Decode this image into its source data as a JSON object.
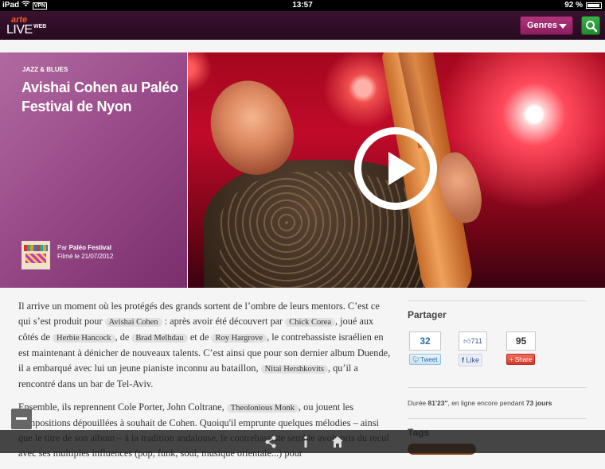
{
  "status_bar": {
    "device": "iPad",
    "vpn": "VPN",
    "time": "13:57",
    "battery": "92 %"
  },
  "header": {
    "logo_arte": "arte",
    "logo_live": "LIVE",
    "logo_web": "WEB",
    "genres_label": "Genres"
  },
  "hero": {
    "category": "JAZZ & BLUES",
    "title": "Avishai Cohen au Paléo Festival de Nyon",
    "by_prefix": "Par ",
    "by_name": "Paléo Festival",
    "filmed": "Filmé le 21/07/2012"
  },
  "article": {
    "p1": {
      "t1": "Il arrive un moment où les protégés des grands sortent de l’ombre de leurs mentors. C’est ce qui s’est produit pour",
      "l1": "Avishai Cohen",
      "t2": ": après avoir été découvert par",
      "l2": "Chick Corea",
      "t3": ", joué aux côtés de",
      "l3": "Herbie Hancock",
      "t4": ", de",
      "l4": "Brad Melhdau",
      "t5": "et de",
      "l5": "Roy Hargrove",
      "t6": ", le contrebassiste israélien en est maintenant à dénicher de nouveaux talents. C’est ainsi que pour son dernier album Duende, il a embarqué avec lui un jeune pianiste inconnu au bataillon,",
      "l6": "Nitai Hershkovits",
      "t7": ", qu’il a rencontré dans un bar de Tel-Aviv."
    },
    "p2": {
      "t1": "Ensemble, ils reprennent Cole Porter, John Coltrane,",
      "l1": "Theolonious Monk",
      "t2": ", ou jouent les compositions dépouillées à souhait de Cohen. Quoiqu'il emprunte quelques mélodies – ainsi que le titre de son album – à la tradition andalouse, le contrebassiste semble avoir pris du recul avec ses multiples influences (pop, funk, soul, musique orientale...) pour"
    }
  },
  "sidebar": {
    "share_title": "Partager",
    "twitter_count": "32",
    "twitter_label": "Tweet",
    "facebook_count": "711",
    "facebook_label": "Like",
    "google_count": "95",
    "google_label": "Share",
    "duration_prefix": "Durée ",
    "duration_value": "81'23\"",
    "duration_mid": ", en ligne encore pendant ",
    "days_value": "73 jours",
    "tags_title": "Tags"
  },
  "colors": {
    "header_bg": "#2e0d26",
    "hero_panel": "#9a4c8a",
    "genres_btn": "#a02a6e",
    "search_btn": "#2e9c3c"
  },
  "icons": [
    "wifi-icon",
    "battery-icon",
    "search-icon",
    "chevron-down-icon",
    "play-icon",
    "share-icon",
    "info-icon",
    "home-icon",
    "minus-icon"
  ]
}
